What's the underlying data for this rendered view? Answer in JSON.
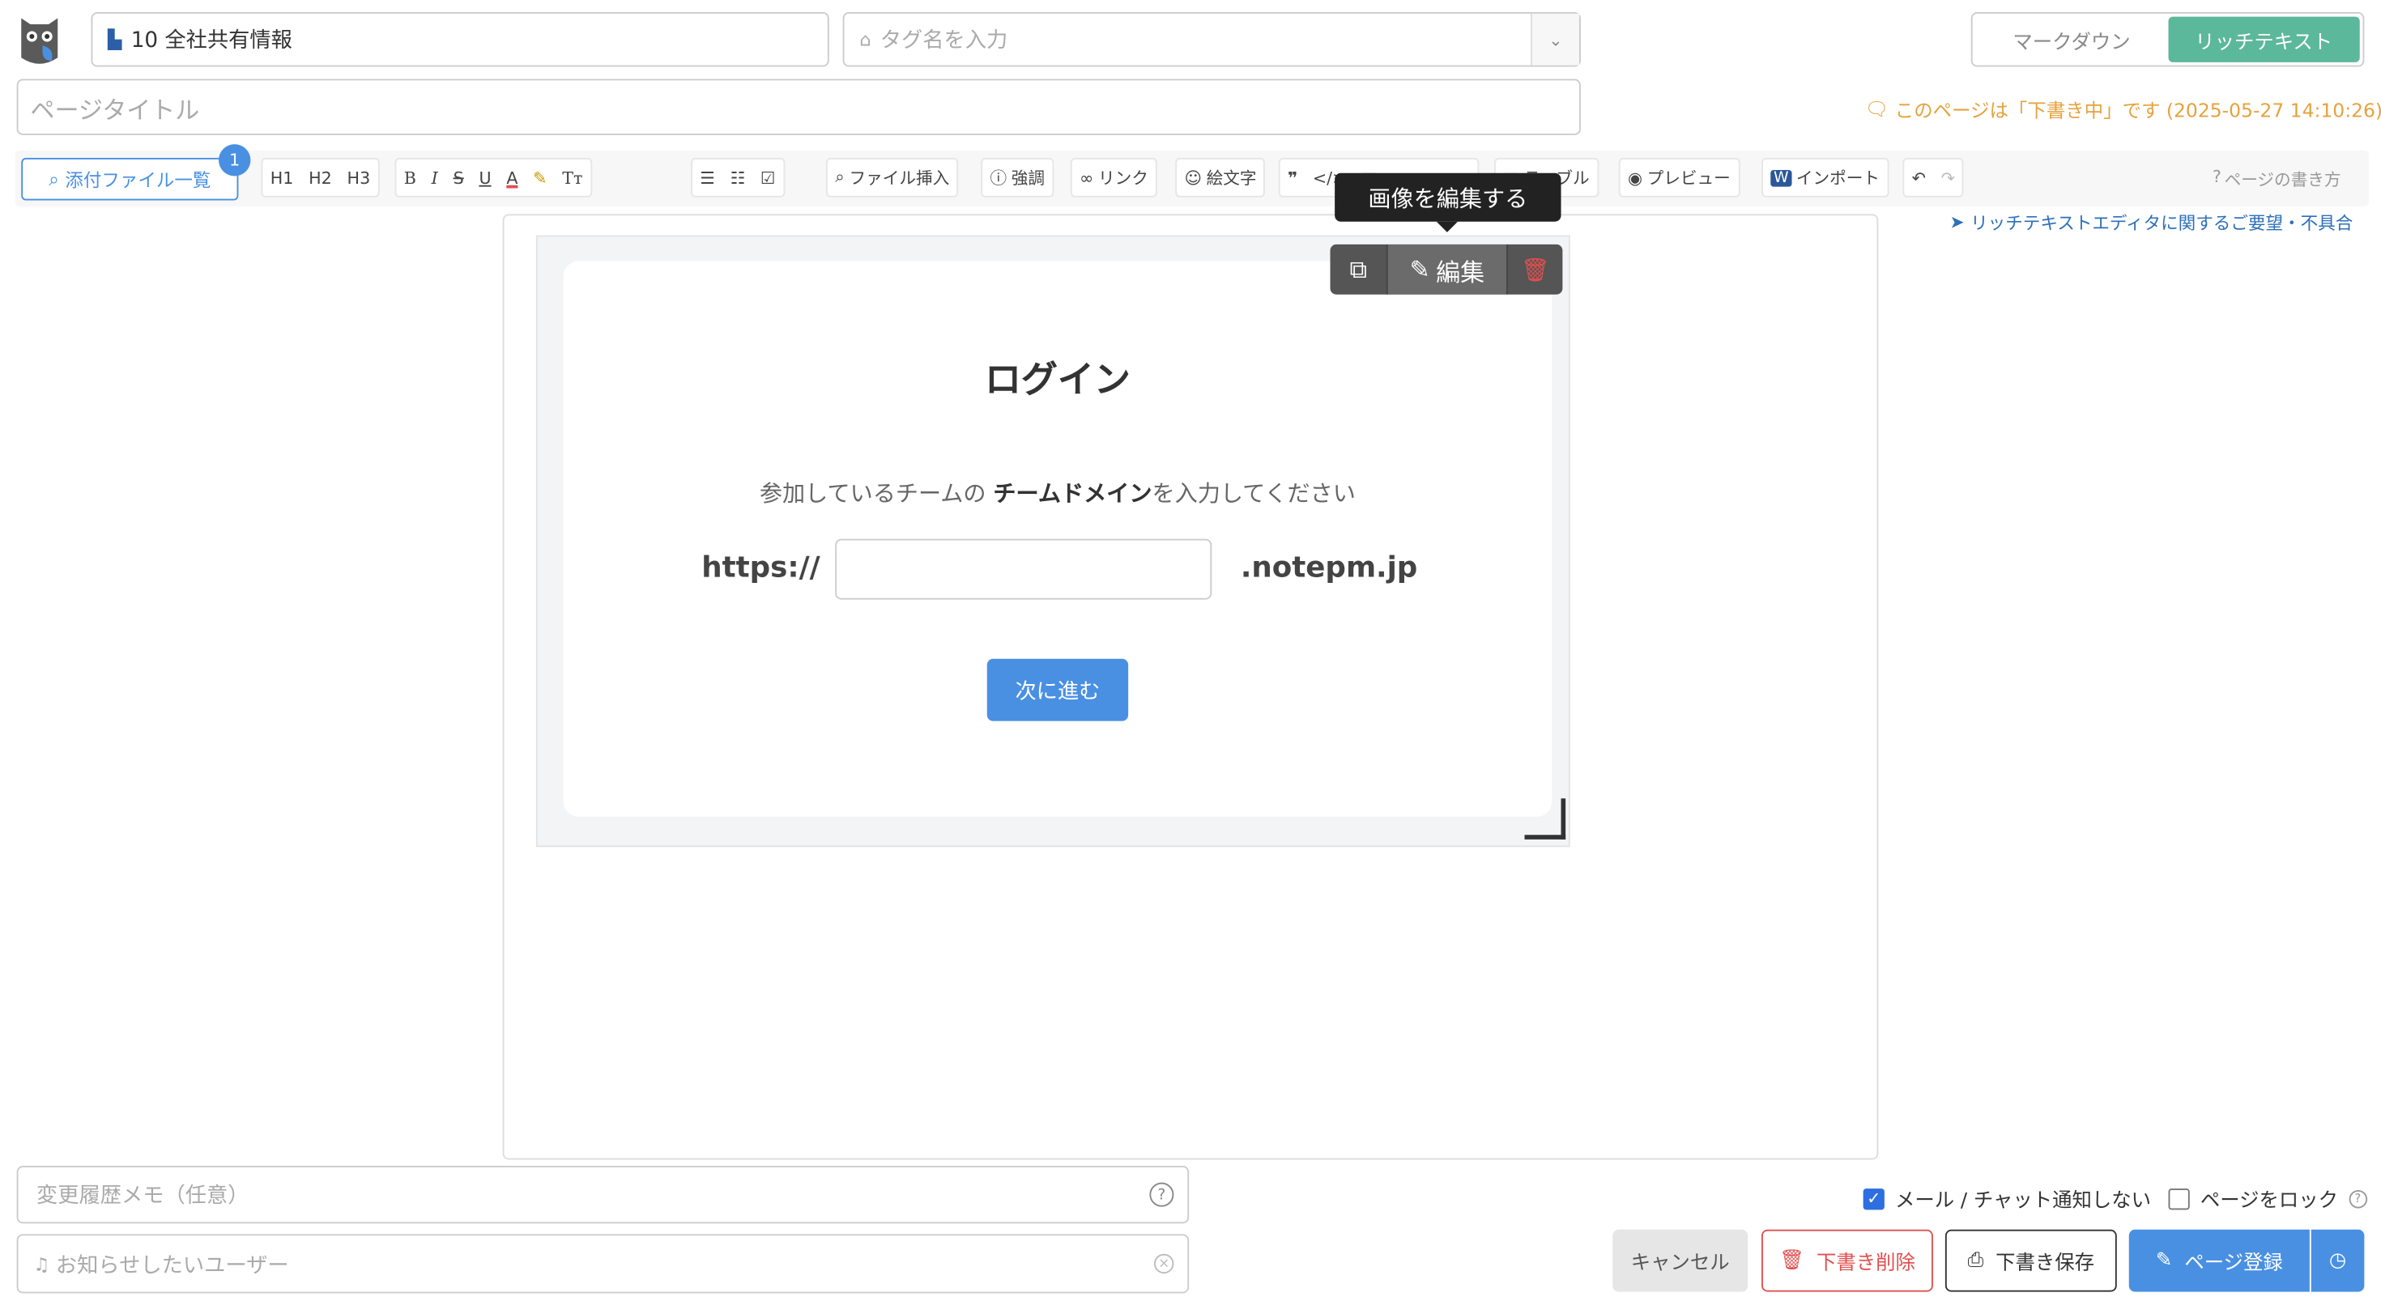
{
  "header": {
    "folder": "10 全社共有情報",
    "tag_placeholder": "タグ名を入力",
    "mode_markdown": "マークダウン",
    "mode_richtext": "リッチテキスト",
    "title_placeholder": "ページタイトル",
    "draft_notice": "このページは「下書き中」です (2025-05-27 14:10:26)"
  },
  "toolbar": {
    "attachments": "添付ファイル一覧",
    "attachments_count": "1",
    "h1": "H1",
    "h2": "H2",
    "h3": "H3",
    "bold": "B",
    "italic": "I",
    "strike": "S",
    "underline": "U",
    "color": "A",
    "clear": "Tт",
    "file_insert": "ファイル挿入",
    "emphasis": "強調",
    "link": "リンク",
    "emoji": "絵文字",
    "quote": "❞",
    "table": "テーブル",
    "preview": "プレビュー",
    "import": "インポート",
    "help": "ページの書き方",
    "feedback": "リッチテキストエディタに関するご要望・不具合"
  },
  "image_tools": {
    "tooltip": "画像を編集する",
    "edit": "編集"
  },
  "login_image": {
    "title": "ログイン",
    "subtitle_pre": "参加しているチームの ",
    "subtitle_bold": "チームドメイン",
    "subtitle_post": "を入力してください",
    "prefix": "https://",
    "suffix": ".notepm.jp",
    "next": "次に進む"
  },
  "footer": {
    "memo_placeholder": "変更履歴メモ（任意）",
    "notify_placeholder": "お知らせしたいユーザー",
    "no_notify": "メール / チャット通知しない",
    "lock": "ページをロック",
    "cancel": "キャンセル",
    "delete_draft": "下書き削除",
    "save_draft": "下書き保存",
    "register": "ページ登録"
  },
  "colors": {
    "accent_green": "#5cb89a",
    "primary_blue": "#4a90e2",
    "draft_orange": "#e6a23c",
    "danger_red": "#e05050"
  }
}
